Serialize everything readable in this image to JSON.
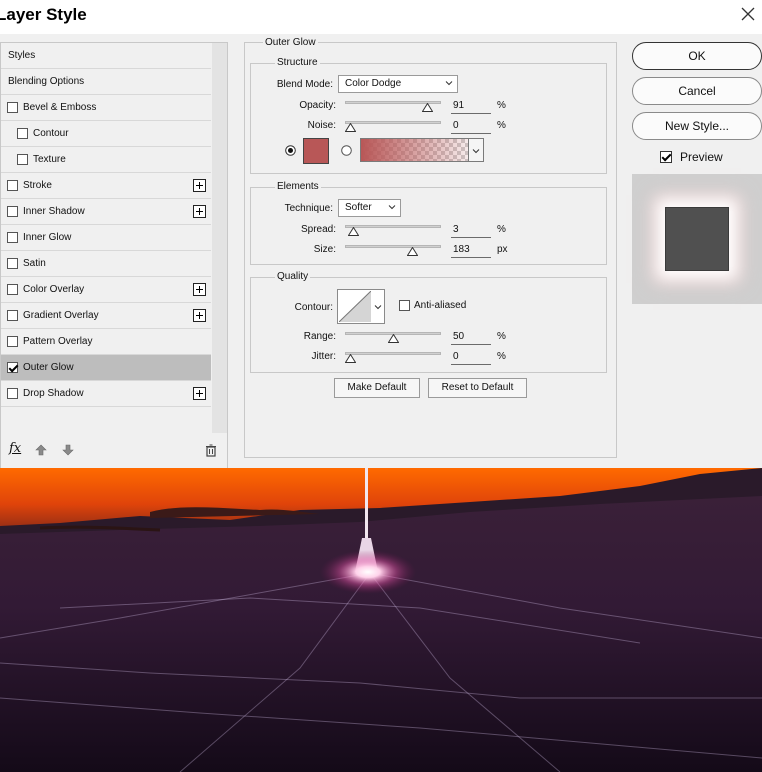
{
  "window": {
    "title": "Layer Style"
  },
  "style_list": {
    "items": [
      {
        "label": "Styles",
        "checkbox": false,
        "plus": false,
        "indent": false,
        "checked": false,
        "selected": false
      },
      {
        "label": "Blending Options",
        "checkbox": false,
        "plus": false,
        "indent": false,
        "checked": false,
        "selected": false
      },
      {
        "label": "Bevel & Emboss",
        "checkbox": true,
        "plus": false,
        "indent": false,
        "checked": false,
        "selected": false
      },
      {
        "label": "Contour",
        "checkbox": true,
        "plus": false,
        "indent": true,
        "checked": false,
        "selected": false
      },
      {
        "label": "Texture",
        "checkbox": true,
        "plus": false,
        "indent": true,
        "checked": false,
        "selected": false
      },
      {
        "label": "Stroke",
        "checkbox": true,
        "plus": true,
        "indent": false,
        "checked": false,
        "selected": false
      },
      {
        "label": "Inner Shadow",
        "checkbox": true,
        "plus": true,
        "indent": false,
        "checked": false,
        "selected": false
      },
      {
        "label": "Inner Glow",
        "checkbox": true,
        "plus": false,
        "indent": false,
        "checked": false,
        "selected": false
      },
      {
        "label": "Satin",
        "checkbox": true,
        "plus": false,
        "indent": false,
        "checked": false,
        "selected": false
      },
      {
        "label": "Color Overlay",
        "checkbox": true,
        "plus": true,
        "indent": false,
        "checked": false,
        "selected": false
      },
      {
        "label": "Gradient Overlay",
        "checkbox": true,
        "plus": true,
        "indent": false,
        "checked": false,
        "selected": false
      },
      {
        "label": "Pattern Overlay",
        "checkbox": true,
        "plus": false,
        "indent": false,
        "checked": false,
        "selected": false
      },
      {
        "label": "Outer Glow",
        "checkbox": true,
        "plus": false,
        "indent": false,
        "checked": true,
        "selected": true
      },
      {
        "label": "Drop Shadow",
        "checkbox": true,
        "plus": true,
        "indent": false,
        "checked": false,
        "selected": false
      }
    ],
    "footer": {
      "fx_label": "fx"
    }
  },
  "outer_glow": {
    "title": "Outer Glow",
    "structure": {
      "title": "Structure",
      "blend_mode_label": "Blend Mode:",
      "blend_mode_value": "Color Dodge",
      "opacity_label": "Opacity:",
      "opacity_value": "91",
      "opacity_unit": "%",
      "noise_label": "Noise:",
      "noise_value": "0",
      "noise_unit": "%",
      "glow_color": "#b85757",
      "opacity_level": 0.91,
      "noise_level": 0.0
    },
    "elements": {
      "title": "Elements",
      "technique_label": "Technique:",
      "technique_value": "Softer",
      "spread_label": "Spread:",
      "spread_value": "3",
      "spread_unit": "%",
      "size_label": "Size:",
      "size_value": "183",
      "size_unit": "px",
      "spread_level": 0.03,
      "size_level": 0.73
    },
    "quality": {
      "title": "Quality",
      "contour_label": "Contour:",
      "anti_aliased_label": "Anti-aliased",
      "range_label": "Range:",
      "range_value": "50",
      "range_unit": "%",
      "jitter_label": "Jitter:",
      "jitter_value": "0",
      "jitter_unit": "%",
      "range_level": 0.5,
      "jitter_level": 0.0
    },
    "buttons": {
      "make_default": "Make Default",
      "reset_default": "Reset to Default"
    }
  },
  "actions": {
    "ok": "OK",
    "cancel": "Cancel",
    "new_style": "New Style...",
    "preview_label": "Preview"
  }
}
